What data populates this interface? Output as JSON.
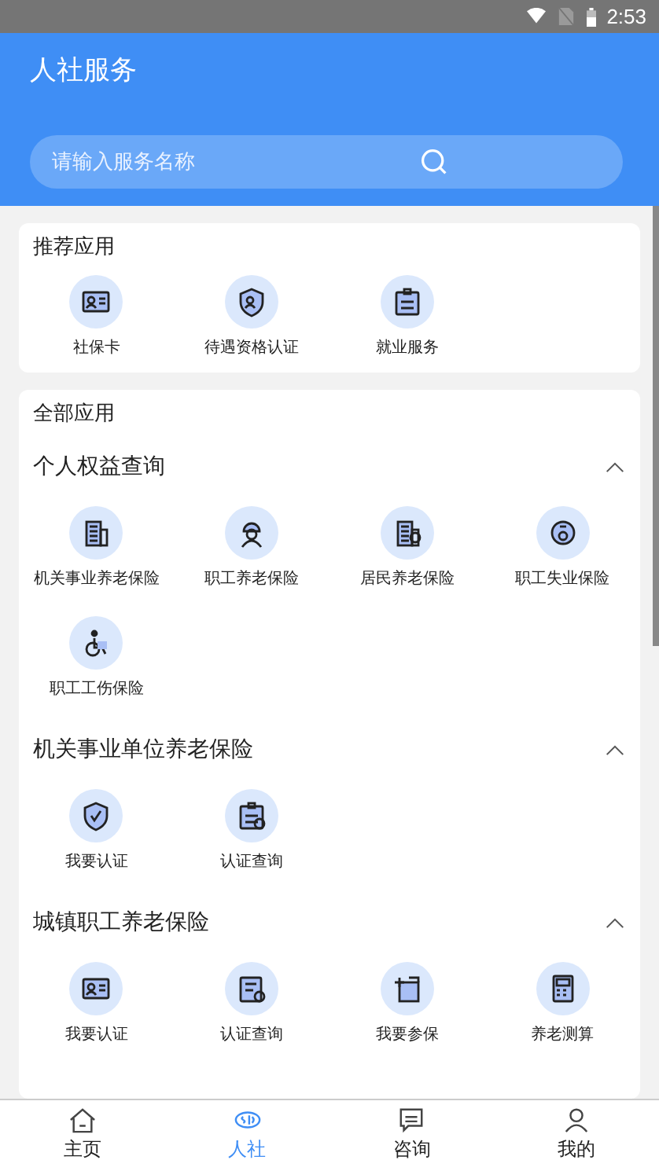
{
  "status_bar": {
    "time": "2:53"
  },
  "header": {
    "title": "人社服务"
  },
  "search": {
    "placeholder": "请输入服务名称"
  },
  "recommended": {
    "title": "推荐应用",
    "items": [
      {
        "label": "社保卡"
      },
      {
        "label": "待遇资格认证"
      },
      {
        "label": "就业服务"
      }
    ]
  },
  "all_apps": {
    "title": "全部应用",
    "sections": [
      {
        "title": "个人权益查询",
        "expanded": true,
        "items": [
          {
            "label": "机关事业养老保险"
          },
          {
            "label": "职工养老保险"
          },
          {
            "label": "居民养老保险"
          },
          {
            "label": "职工失业保险"
          },
          {
            "label": "职工工伤保险"
          }
        ]
      },
      {
        "title": "机关事业单位养老保险",
        "expanded": true,
        "items": [
          {
            "label": "我要认证"
          },
          {
            "label": "认证查询"
          }
        ]
      },
      {
        "title": "城镇职工养老保险",
        "expanded": true,
        "items": [
          {
            "label": "我要认证"
          },
          {
            "label": "认证查询"
          },
          {
            "label": "我要参保"
          },
          {
            "label": "养老测算"
          }
        ]
      }
    ]
  },
  "bottom_nav": [
    {
      "label": "主页",
      "selected": false
    },
    {
      "label": "人社",
      "selected": true
    },
    {
      "label": "咨询",
      "selected": false
    },
    {
      "label": "我的",
      "selected": false
    }
  ]
}
